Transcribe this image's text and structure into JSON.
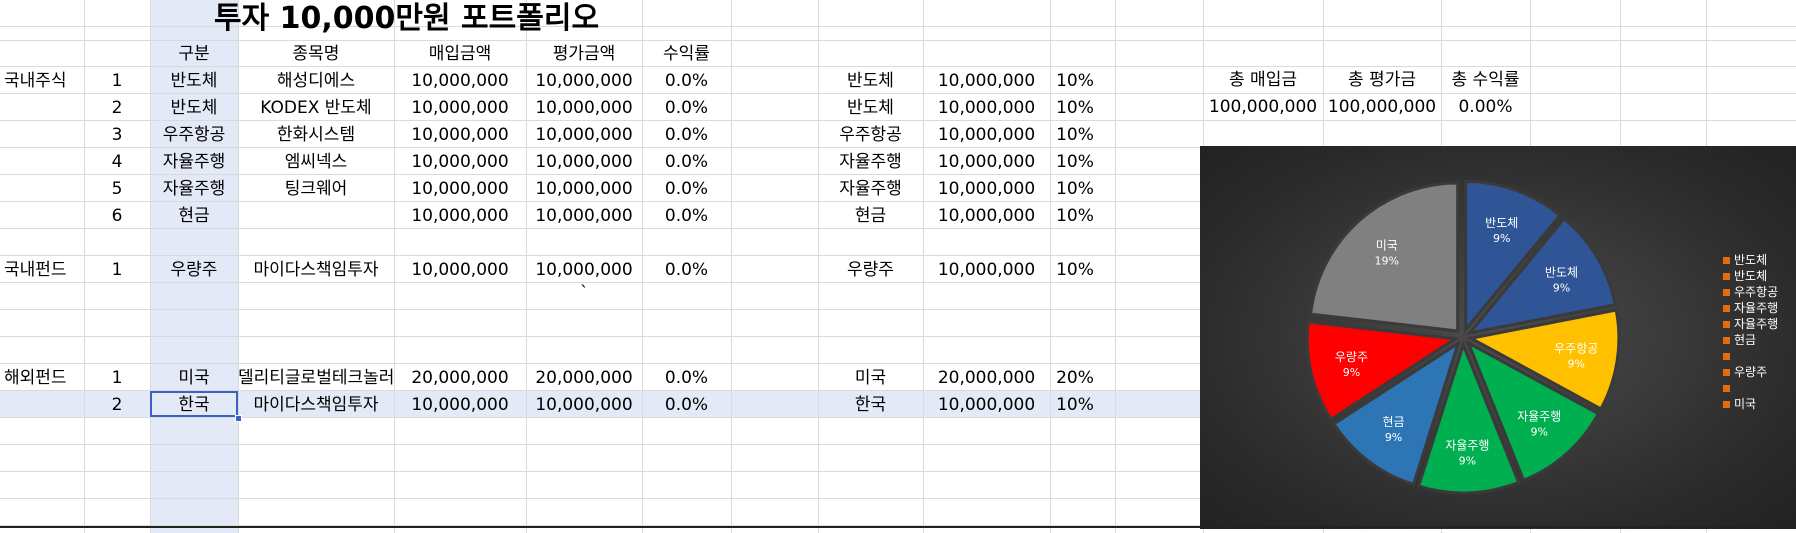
{
  "title": "투자 10,000만원 포트폴리오",
  "headers": [
    "구분",
    "종목명",
    "매입금액",
    "평가금액",
    "수익률"
  ],
  "groups": {
    "domestic_stock": "국내주식",
    "domestic_fund": "국내펀드",
    "overseas_fund": "해외펀드"
  },
  "rows": [
    {
      "group": "국내주식",
      "no": "1",
      "cat": "반도체",
      "name": "해성디에스",
      "buy": "10,000,000",
      "eval": "10,000,000",
      "ret": "0.0%",
      "s_cat": "반도체",
      "s_amt": "10,000,000",
      "s_pct": "10%"
    },
    {
      "group": "",
      "no": "2",
      "cat": "반도체",
      "name": "KODEX 반도체",
      "buy": "10,000,000",
      "eval": "10,000,000",
      "ret": "0.0%",
      "s_cat": "반도체",
      "s_amt": "10,000,000",
      "s_pct": "10%"
    },
    {
      "group": "",
      "no": "3",
      "cat": "우주항공",
      "name": "한화시스템",
      "buy": "10,000,000",
      "eval": "10,000,000",
      "ret": "0.0%",
      "s_cat": "우주항공",
      "s_amt": "10,000,000",
      "s_pct": "10%"
    },
    {
      "group": "",
      "no": "4",
      "cat": "자율주행",
      "name": "엠씨넥스",
      "buy": "10,000,000",
      "eval": "10,000,000",
      "ret": "0.0%",
      "s_cat": "자율주행",
      "s_amt": "10,000,000",
      "s_pct": "10%"
    },
    {
      "group": "",
      "no": "5",
      "cat": "자율주행",
      "name": "팅크웨어",
      "buy": "10,000,000",
      "eval": "10,000,000",
      "ret": "0.0%",
      "s_cat": "자율주행",
      "s_amt": "10,000,000",
      "s_pct": "10%"
    },
    {
      "group": "",
      "no": "6",
      "cat": "현금",
      "name": "",
      "buy": "10,000,000",
      "eval": "10,000,000",
      "ret": "0.0%",
      "s_cat": "현금",
      "s_amt": "10,000,000",
      "s_pct": "10%"
    },
    {
      "group": "국내펀드",
      "no": "1",
      "cat": "우량주",
      "name": "마이다스책임투자",
      "buy": "10,000,000",
      "eval": "10,000,000",
      "ret": "0.0%",
      "s_cat": "우량주",
      "s_amt": "10,000,000",
      "s_pct": "10%"
    },
    {
      "group": "해외펀드",
      "no": "1",
      "cat": "미국",
      "name": "델리티글로벌테크놀러",
      "buy": "20,000,000",
      "eval": "20,000,000",
      "ret": "0.0%",
      "s_cat": "미국",
      "s_amt": "20,000,000",
      "s_pct": "20%"
    },
    {
      "group": "",
      "no": "2",
      "cat": "한국",
      "name": "마이다스책임투자",
      "buy": "10,000,000",
      "eval": "10,000,000",
      "ret": "0.0%",
      "s_cat": "한국",
      "s_amt": "10,000,000",
      "s_pct": "10%"
    }
  ],
  "stray_tick": "`",
  "totals": {
    "headers": [
      "총 매입금",
      "총 평가금",
      "총 수익률"
    ],
    "values": [
      "100,000,000",
      "100,000,000",
      "0.00%"
    ]
  },
  "colors": {
    "selection": "#3a62c4",
    "highlight": "#e3e9f6",
    "legend_marker": "#e46c0a"
  },
  "chart_data": {
    "type": "pie",
    "title": "",
    "slices": [
      {
        "label": "반도체",
        "pct_label": "9%",
        "value": 9,
        "color": "#2f5597"
      },
      {
        "label": "반도체",
        "pct_label": "9%",
        "value": 9,
        "color": "#2f5597"
      },
      {
        "label": "우주항공",
        "pct_label": "9%",
        "value": 9,
        "color": "#ffc000"
      },
      {
        "label": "자율주행",
        "pct_label": "9%",
        "value": 9,
        "color": "#00b050"
      },
      {
        "label": "자율주행",
        "pct_label": "9%",
        "value": 9,
        "color": "#00b050"
      },
      {
        "label": "현금",
        "pct_label": "9%",
        "value": 9,
        "color": "#2e75b6"
      },
      {
        "label": "우량주",
        "pct_label": "9%",
        "value": 9,
        "color": "#ff0000"
      },
      {
        "label": "미국",
        "pct_label": "19%",
        "value": 19,
        "color": "#808080"
      }
    ],
    "legend": [
      "반도체",
      "반도체",
      "우주항공",
      "자율주행",
      "자율주행",
      "현금",
      "",
      "우량주",
      "",
      "미국"
    ],
    "legend_position": "right"
  }
}
